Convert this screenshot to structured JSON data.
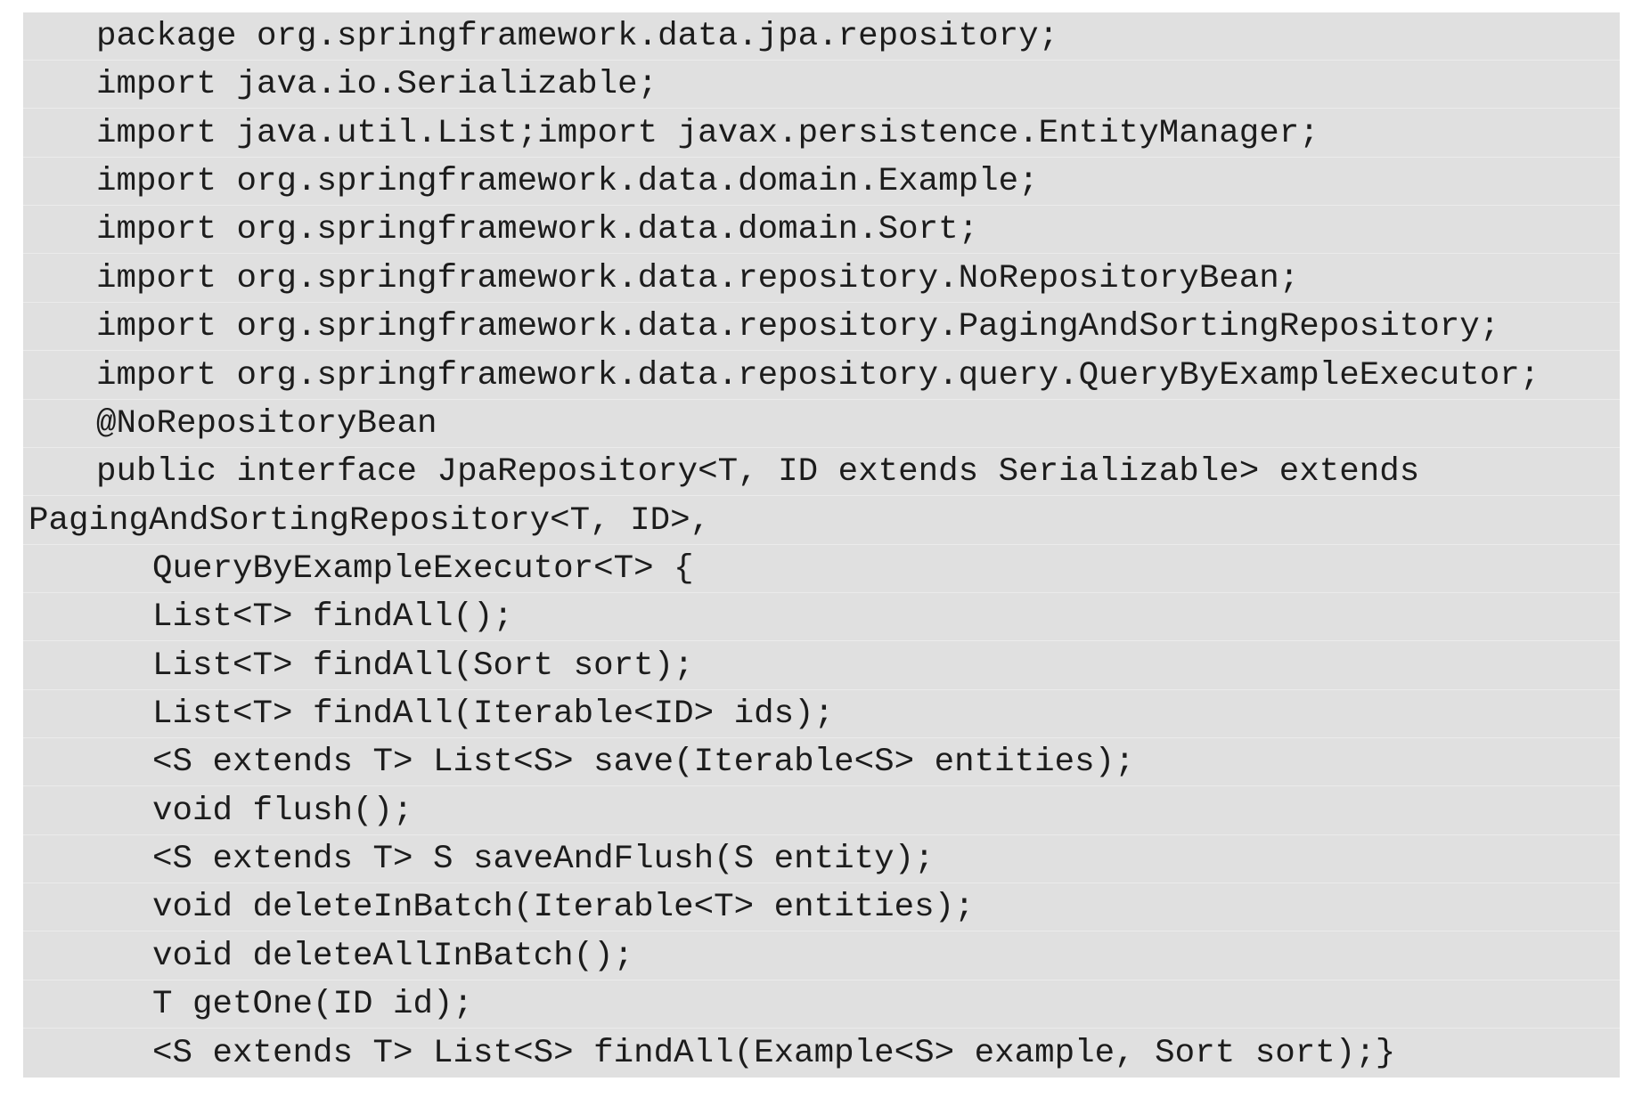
{
  "code": {
    "lines": [
      {
        "indent": 1,
        "text": "package org.springframework.data.jpa.repository;"
      },
      {
        "indent": 1,
        "text": "import java.io.Serializable;"
      },
      {
        "indent": 1,
        "text": "import java.util.List;import javax.persistence.EntityManager;"
      },
      {
        "indent": 1,
        "text": "import org.springframework.data.domain.Example;"
      },
      {
        "indent": 1,
        "text": "import org.springframework.data.domain.Sort;"
      },
      {
        "indent": 1,
        "text": "import org.springframework.data.repository.NoRepositoryBean;"
      },
      {
        "indent": 1,
        "text": "import org.springframework.data.repository.PagingAndSortingRepository;"
      },
      {
        "indent": 1,
        "text": "import org.springframework.data.repository.query.QueryByExampleExecutor;"
      },
      {
        "indent": 1,
        "text": "@NoRepositoryBean"
      },
      {
        "indent": 1,
        "text": "public interface JpaRepository<T, ID extends Serializable> extends"
      },
      {
        "indent": 0,
        "text": "PagingAndSortingRepository<T, ID>,"
      },
      {
        "indent": 2,
        "text": "QueryByExampleExecutor<T> {"
      },
      {
        "indent": 2,
        "text": "List<T> findAll();"
      },
      {
        "indent": 2,
        "text": "List<T> findAll(Sort sort);"
      },
      {
        "indent": 2,
        "text": "List<T> findAll(Iterable<ID> ids);"
      },
      {
        "indent": 2,
        "text": "<S extends T> List<S> save(Iterable<S> entities);"
      },
      {
        "indent": 2,
        "text": "void flush();"
      },
      {
        "indent": 2,
        "text": "<S extends T> S saveAndFlush(S entity);"
      },
      {
        "indent": 2,
        "text": "void deleteInBatch(Iterable<T> entities);"
      },
      {
        "indent": 2,
        "text": "void deleteAllInBatch();"
      },
      {
        "indent": 2,
        "text": "T getOne(ID id);"
      },
      {
        "indent": 2,
        "text": "<S extends T> List<S> findAll(Example<S> example, Sort sort);}"
      }
    ]
  }
}
